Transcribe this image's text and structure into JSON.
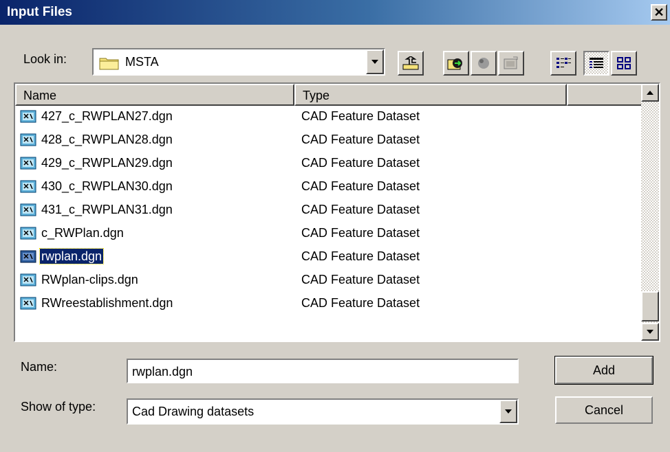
{
  "window": {
    "title": "Input Files",
    "close_glyph": "✕"
  },
  "lookin": {
    "label": "Look in:",
    "value": "MSTA"
  },
  "toolbar": {
    "icons": [
      "up-folder-icon",
      "connect-folder-icon",
      "disconnect-folder-icon",
      "catalog-icon",
      "list-view-icon",
      "details-view-icon",
      "thumbnails-view-icon"
    ]
  },
  "filelist": {
    "columns": [
      "Name",
      "Type",
      ""
    ],
    "rows": [
      {
        "name": "427_c_RWPLAN27.dgn",
        "type": "CAD Feature Dataset",
        "selected": false
      },
      {
        "name": "428_c_RWPLAN28.dgn",
        "type": "CAD Feature Dataset",
        "selected": false
      },
      {
        "name": "429_c_RWPLAN29.dgn",
        "type": "CAD Feature Dataset",
        "selected": false
      },
      {
        "name": "430_c_RWPLAN30.dgn",
        "type": "CAD Feature Dataset",
        "selected": false
      },
      {
        "name": "431_c_RWPLAN31.dgn",
        "type": "CAD Feature Dataset",
        "selected": false
      },
      {
        "name": "c_RWPlan.dgn",
        "type": "CAD Feature Dataset",
        "selected": false
      },
      {
        "name": "rwplan.dgn",
        "type": "CAD Feature Dataset",
        "selected": true
      },
      {
        "name": "RWplan-clips.dgn",
        "type": "CAD Feature Dataset",
        "selected": false
      },
      {
        "name": "RWreestablishment.dgn",
        "type": "CAD Feature Dataset",
        "selected": false
      }
    ]
  },
  "name_field": {
    "label": "Name:",
    "value": "rwplan.dgn"
  },
  "type_field": {
    "label": "Show of type:",
    "value": "Cad Drawing datasets"
  },
  "buttons": {
    "add": "Add",
    "cancel": "Cancel"
  },
  "colors": {
    "title_start": "#0a246a",
    "title_end": "#a6caf0",
    "face": "#d4d0c8",
    "selection": "#0a246a"
  }
}
